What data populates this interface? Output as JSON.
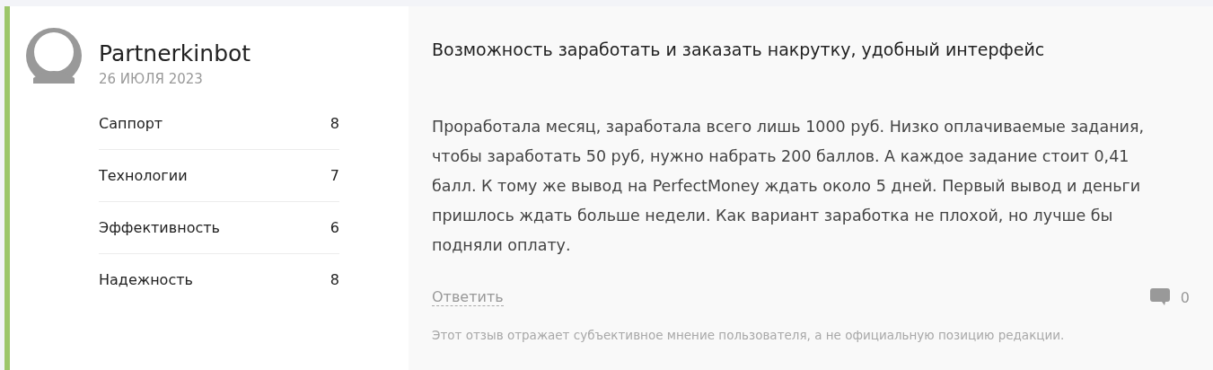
{
  "author": {
    "name": "Partnerkinbot",
    "date": "26 ИЮЛЯ 2023"
  },
  "ratings": [
    {
      "label": "Саппорт",
      "score": "8"
    },
    {
      "label": "Технологии",
      "score": "7"
    },
    {
      "label": "Эффективность",
      "score": "6"
    },
    {
      "label": "Надежность",
      "score": "8"
    }
  ],
  "review": {
    "title": "Возможность заработать и заказать накрутку, удобный интерфейс",
    "body": "Проработала месяц, заработала всего лишь 1000 руб. Низко оплачиваемые задания, чтобы заработать 50 руб, нужно набрать 200 баллов. А каждое задание стоит 0,41 балл. К тому же вывод на PerfectMoney ждать около 5 дней. Первый вывод и деньги пришлось ждать больше недели. Как вариант заработка не плохой, но лучше бы подняли оплату.",
    "reply_link": "Ответить",
    "comment_count": "0",
    "disclaimer": "Этот отзыв отражает субъективное мнение пользователя, а не официальную позицию редакции."
  }
}
